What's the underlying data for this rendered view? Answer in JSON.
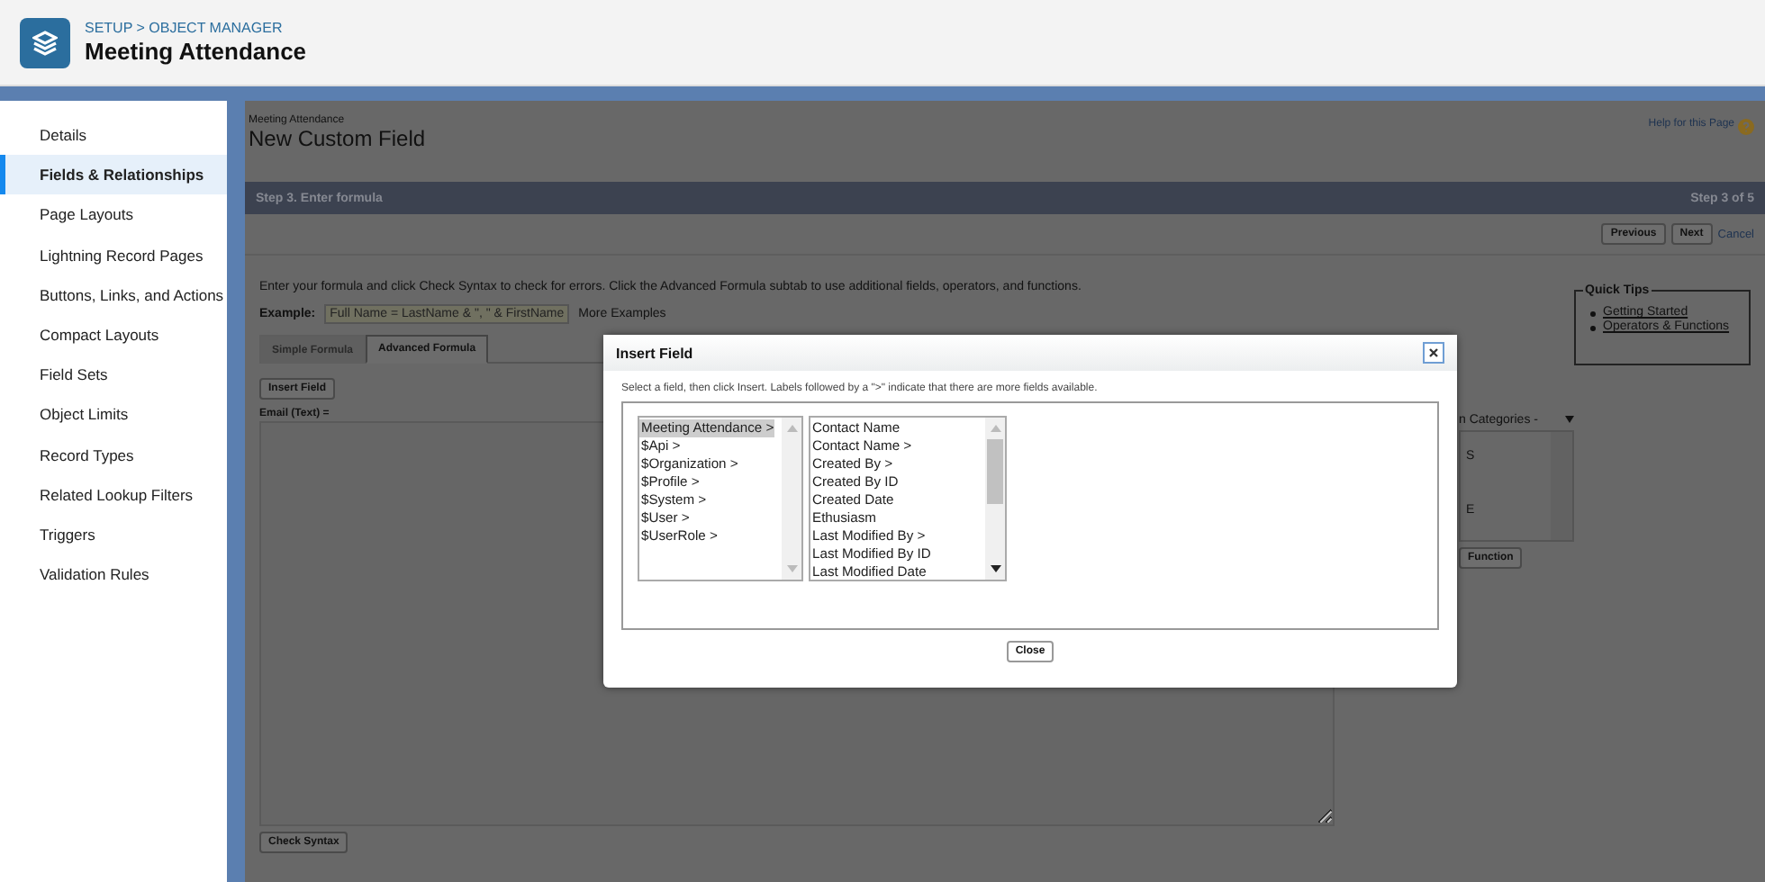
{
  "header": {
    "breadcrumb": "SETUP > OBJECT MANAGER",
    "title": "Meeting Attendance"
  },
  "sidebar": {
    "items": [
      {
        "label": "Details",
        "selected": false
      },
      {
        "label": "Fields & Relationships",
        "selected": true
      },
      {
        "label": "Page Layouts",
        "selected": false
      },
      {
        "label": "Lightning Record Pages",
        "selected": false
      },
      {
        "label": "Buttons, Links, and Actions",
        "selected": false
      },
      {
        "label": "Compact Layouts",
        "selected": false
      },
      {
        "label": "Field Sets",
        "selected": false
      },
      {
        "label": "Object Limits",
        "selected": false
      },
      {
        "label": "Record Types",
        "selected": false
      },
      {
        "label": "Related Lookup Filters",
        "selected": false
      },
      {
        "label": "Triggers",
        "selected": false
      },
      {
        "label": "Validation Rules",
        "selected": false
      }
    ]
  },
  "page": {
    "object_label": "Meeting Attendance",
    "title": "New Custom Field",
    "help_link": "Help for this Page"
  },
  "step_bar": {
    "title": "Step 3. Enter formula",
    "progress": "Step 3 of 5"
  },
  "nav_buttons": [
    "Previous",
    "Next"
  ],
  "cancel_link": "Cancel",
  "instructions": "Enter your formula and click Check Syntax to check for errors. Click the Advanced Formula subtab to use additional fields, operators, and functions.",
  "example": {
    "label": "Example:",
    "value": "Full Name = LastName & \", \" & FirstName",
    "more_link": "More Examples"
  },
  "tabs": [
    {
      "label": "Simple Formula",
      "selected": false
    },
    {
      "label": "Advanced Formula",
      "selected": true
    }
  ],
  "insert_field_button": "Insert Field",
  "formula_label": "Email (Text) =",
  "check_syntax_button": "Check Syntax",
  "function_panel": {
    "select": "n Categories -",
    "items": [
      "S",
      "E"
    ],
    "button": "Function"
  },
  "quick_tips": {
    "title": "Quick Tips",
    "links": [
      "Getting Started",
      "Operators & Functions"
    ]
  },
  "dialog": {
    "title": "Insert Field",
    "instructions": "Select a field, then click Insert. Labels followed by a \">\" indicate that there are more fields available.",
    "list_1": [
      {
        "label": "Meeting Attendance >",
        "selected": true
      },
      {
        "label": "$Api >",
        "selected": false
      },
      {
        "label": "$Organization >",
        "selected": false
      },
      {
        "label": "$Profile >",
        "selected": false
      },
      {
        "label": "$System >",
        "selected": false
      },
      {
        "label": "$User >",
        "selected": false
      },
      {
        "label": "$UserRole >",
        "selected": false
      }
    ],
    "list_2": [
      {
        "label": "Contact Name",
        "selected": false
      },
      {
        "label": "Contact Name >",
        "selected": false
      },
      {
        "label": "Created By >",
        "selected": false
      },
      {
        "label": "Created By ID",
        "selected": false
      },
      {
        "label": "Created Date",
        "selected": false
      },
      {
        "label": "Ethusiasm",
        "selected": false
      },
      {
        "label": "Last Modified By >",
        "selected": false
      },
      {
        "label": "Last Modified By ID",
        "selected": false
      },
      {
        "label": "Last Modified Date",
        "selected": false
      }
    ],
    "close_button": "Close"
  }
}
